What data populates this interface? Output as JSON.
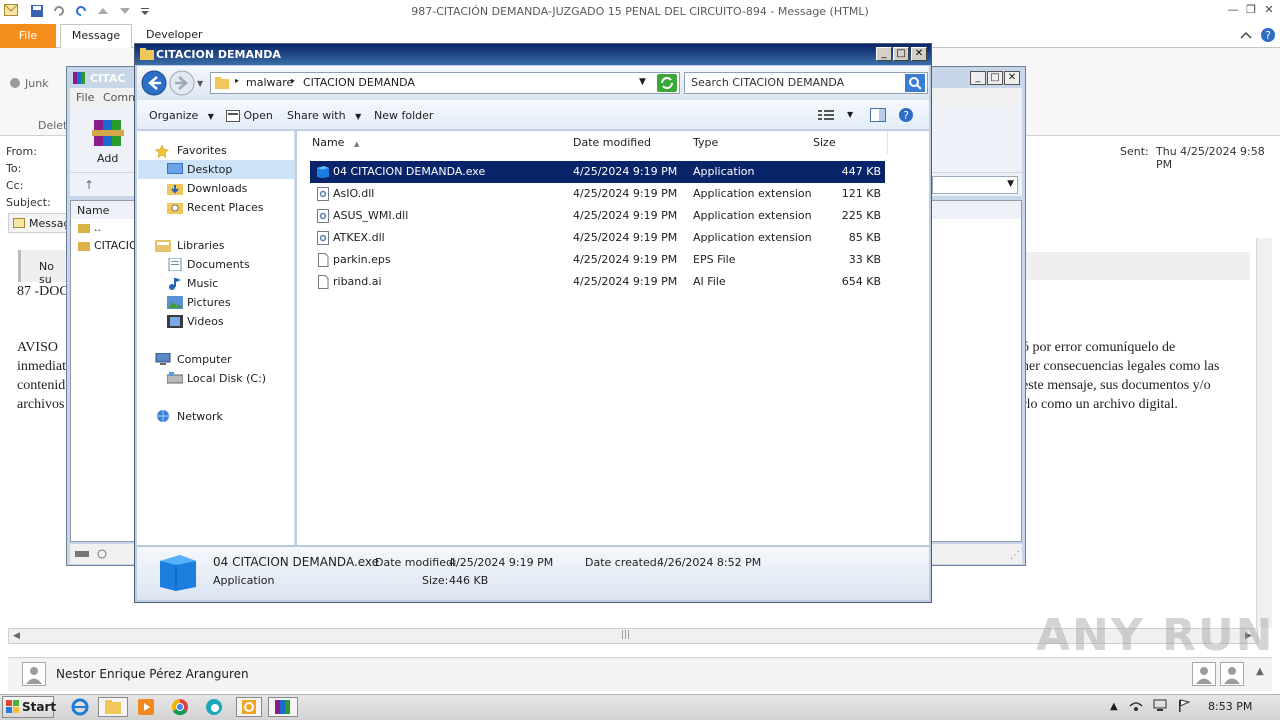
{
  "outlook": {
    "title": "987-CITACIÓN  DEMANDA-JUZGADO 15 PENAL DEL CIRCUITO-894  -  Message (HTML)",
    "tabs": {
      "file": "File",
      "message": "Message",
      "developer": "Developer"
    },
    "ribbon": {
      "junk": "Junk",
      "delete": "Delet"
    },
    "headers": {
      "from_label": "From:",
      "to_label": "To:",
      "cc_label": "Cc:",
      "subject_label": "Subject:",
      "sent_label": "Sent:",
      "sent_value": "Thu 4/25/2024 9:58 PM"
    },
    "message_tab": "Messag",
    "body": {
      "notice_left": "No su",
      "line87": "87 -DOC",
      "aviso_lines": [
        "AVISO",
        "inmediat",
        "contenid",
        "archivos"
      ],
      "right_lines": [
        "ó por error comuníquelo de",
        "ner consecuencias legales como las",
        "este mensaje, sus documentos y/o",
        "rlo como un archivo digital."
      ]
    },
    "people_pane_name": "Nestor Enrique Pérez Aranguren"
  },
  "winrar": {
    "title": "CITAC",
    "menu": {
      "file": "File",
      "commands": "Comm"
    },
    "add_label": "Add",
    "col_name": "Name",
    "rows": [
      "..",
      "CITACIO"
    ]
  },
  "explorer": {
    "title": "CITACION DEMANDA",
    "breadcrumb": [
      "malware",
      "CITACION DEMANDA"
    ],
    "search_placeholder": "Search CITACION DEMANDA",
    "commands": {
      "organize": "Organize",
      "open": "Open",
      "share_with": "Share with",
      "new_folder": "New folder"
    },
    "nav": {
      "favorites": "Favorites",
      "desktop": "Desktop",
      "downloads": "Downloads",
      "recent_places": "Recent Places",
      "libraries": "Libraries",
      "documents": "Documents",
      "music": "Music",
      "pictures": "Pictures",
      "videos": "Videos",
      "computer": "Computer",
      "local_disk": "Local Disk (C:)",
      "network": "Network"
    },
    "columns": [
      "Name",
      "Date modified",
      "Type",
      "Size"
    ],
    "files": [
      {
        "name": "04 CITACION DEMANDA.exe",
        "date": "4/25/2024 9:19 PM",
        "type": "Application",
        "size": "447 KB",
        "icon": "exe-icon"
      },
      {
        "name": "AsIO.dll",
        "date": "4/25/2024 9:19 PM",
        "type": "Application extension",
        "size": "121 KB",
        "icon": "dll-icon"
      },
      {
        "name": "ASUS_WMI.dll",
        "date": "4/25/2024 9:19 PM",
        "type": "Application extension",
        "size": "225 KB",
        "icon": "dll-icon"
      },
      {
        "name": "ATKEX.dll",
        "date": "4/25/2024 9:19 PM",
        "type": "Application extension",
        "size": "85 KB",
        "icon": "dll-icon"
      },
      {
        "name": "parkin.eps",
        "date": "4/25/2024 9:19 PM",
        "type": "EPS File",
        "size": "33 KB",
        "icon": "file-icon"
      },
      {
        "name": "riband.ai",
        "date": "4/25/2024 9:19 PM",
        "type": "AI File",
        "size": "654 KB",
        "icon": "file-icon"
      }
    ],
    "details": {
      "filename": "04 CITACION DEMANDA.exe",
      "type": "Application",
      "date_modified_label": "Date modified:",
      "date_modified": "4/25/2024 9:19 PM",
      "size_label": "Size:",
      "size": "446 KB",
      "date_created_label": "Date created:",
      "date_created": "4/26/2024 8:52 PM"
    }
  },
  "taskbar": {
    "start": "Start",
    "clock": "8:53 PM"
  },
  "watermark": "ANY RUN",
  "colors": {
    "file_tab": "#f38d1c",
    "selection": "#0a246a",
    "title_gradient_start": "#0a246a",
    "title_gradient_end": "#3a6ea5"
  }
}
